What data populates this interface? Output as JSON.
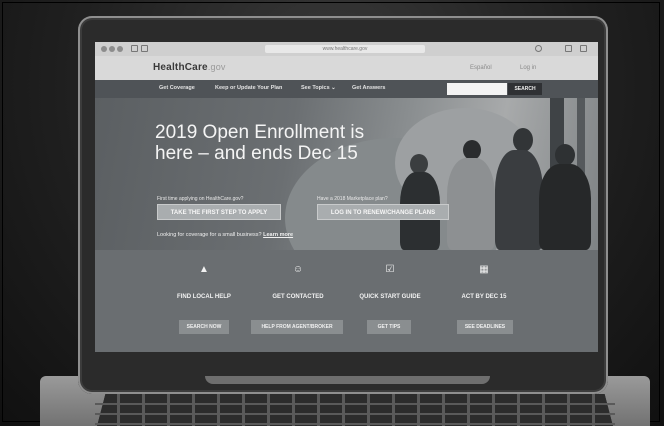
{
  "browser": {
    "url": "www.healthcare.gov"
  },
  "header": {
    "logo_main": "HealthCare",
    "logo_suffix": ".gov",
    "language_link": "Español",
    "login_link": "Log in"
  },
  "nav": {
    "items": [
      "Get Coverage",
      "Keep or Update Your Plan",
      "See Topics ⌄",
      "Get Answers"
    ],
    "search_button": "SEARCH",
    "search_placeholder": ""
  },
  "hero": {
    "title_line1": "2019 Open Enrollment is",
    "title_line2": "here – and ends Dec 15",
    "q1": "First time applying on HealthCare.gov?",
    "q2": "Have a 2018 Marketplace plan?",
    "apply_button": "TAKE THE FIRST STEP TO APPLY",
    "renew_button": "LOG IN TO RENEW/CHANGE PLANS",
    "small_business_text": "Looking for coverage for a small business?",
    "small_business_link": "Learn more"
  },
  "tiles": [
    {
      "icon": "road-icon",
      "glyph": "▲",
      "title": "FIND LOCAL HELP",
      "button": "SEARCH NOW"
    },
    {
      "icon": "people-icon",
      "glyph": "☺",
      "title": "GET CONTACTED",
      "button": "HELP FROM AGENT/BROKER"
    },
    {
      "icon": "checklist-icon",
      "glyph": "☑",
      "title": "QUICK START GUIDE",
      "button": "GET TIPS"
    },
    {
      "icon": "calendar-icon",
      "glyph": "▦",
      "title": "ACT BY DEC 15",
      "button": "SEE DEADLINES"
    }
  ],
  "colors": {
    "nav_bg": "#4f5357",
    "header_bg": "#d9d9d9",
    "tile_bg": "#6a6e71"
  }
}
